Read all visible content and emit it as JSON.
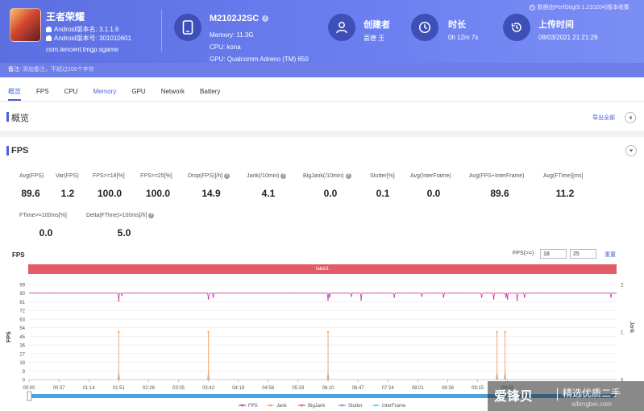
{
  "app": {
    "title": "王者荣耀",
    "version_line": "Android版本名: 3.1.1.6",
    "code_line": "Android版本号: 301010601",
    "package": "com.tencent.tmgp.sgame"
  },
  "device": {
    "name": "M2102J2SC",
    "memory": "Memory: 11.3G",
    "cpu": "CPU: kona",
    "gpu": "GPU: Qualcomm Adreno (TM) 650"
  },
  "creator": {
    "label": "创建者",
    "value": "喜德 王"
  },
  "duration": {
    "label": "时长",
    "value": "0h 12m 7s"
  },
  "upload": {
    "label": "上传时间",
    "value": "08/03/2021 21:21:29"
  },
  "source_note": "数据由PerfDog(5.1.210204)版本收集",
  "remark": {
    "label": "备注:",
    "placeholder": "添加备注，不超过200个字符"
  },
  "tabs": [
    "概览",
    "FPS",
    "CPU",
    "Memory",
    "GPU",
    "Network",
    "Battery"
  ],
  "active_tab": "概览",
  "overview": {
    "title": "概览",
    "export": "导出全部"
  },
  "fps_section": {
    "title": "FPS"
  },
  "metrics": [
    {
      "label": "Avg(FPS)",
      "value": "89.6",
      "help": false
    },
    {
      "label": "Var(FPS)",
      "value": "1.2",
      "help": false
    },
    {
      "label": "FPS>=18[%]",
      "value": "100.0",
      "help": false
    },
    {
      "label": "FPS>=25[%]",
      "value": "100.0",
      "help": false
    },
    {
      "label": "Drop(FPS)[/h]",
      "value": "14.9",
      "help": true
    },
    {
      "label": "Jank(/10min)",
      "value": "4.1",
      "help": true
    },
    {
      "label": "BigJank(/10min)",
      "value": "0.0",
      "help": true
    },
    {
      "label": "Stutter[%]",
      "value": "0.1",
      "help": false
    },
    {
      "label": "Avg(InterFrame)",
      "value": "0.0",
      "help": false
    },
    {
      "label": "Avg(FPS+InterFrame)",
      "value": "89.6",
      "help": false
    },
    {
      "label": "Avg(FTime)[ms]",
      "value": "11.2",
      "help": false
    },
    {
      "label": "FTime>=100ms[%]",
      "value": "0.0",
      "help": false
    },
    {
      "label": "Delta(FTime)>100ms[/h]",
      "value": "5.0",
      "help": true
    }
  ],
  "chart_controls": {
    "title": "FPS",
    "threshold_label": "FPS(>=)",
    "threshold_1": "18",
    "threshold_2": "25",
    "reset": "重置",
    "band_label": "label1"
  },
  "chart_data": {
    "type": "line",
    "ylabel": "FPS",
    "y2label": "Jank",
    "ylim": [
      0,
      99
    ],
    "y_ticks": [
      0,
      9,
      18,
      27,
      36,
      45,
      54,
      63,
      72,
      81,
      90,
      99
    ],
    "y2lim": [
      0,
      2
    ],
    "y2_ticks": [
      0,
      1,
      2
    ],
    "x_ticks": [
      "00:00",
      "00:37",
      "01:14",
      "01:51",
      "02:28",
      "03:05",
      "03:42",
      "04:19",
      "04:56",
      "05:33",
      "06:10",
      "06:47",
      "07:24",
      "08:01",
      "08:38",
      "09:15",
      "09:52"
    ],
    "duration_seconds": 727,
    "fps_baseline": 90,
    "fps_dips": [
      {
        "t": 111,
        "value": 82
      },
      {
        "t": 115,
        "value": 88
      },
      {
        "t": 222,
        "value": 84
      },
      {
        "t": 228,
        "value": 86
      },
      {
        "t": 370,
        "value": 83
      },
      {
        "t": 372,
        "value": 86
      },
      {
        "t": 399,
        "value": 87
      },
      {
        "t": 411,
        "value": 83
      },
      {
        "t": 452,
        "value": 86
      },
      {
        "t": 486,
        "value": 87
      },
      {
        "t": 513,
        "value": 86
      },
      {
        "t": 560,
        "value": 86
      },
      {
        "t": 575,
        "value": 84
      },
      {
        "t": 590,
        "value": 86
      },
      {
        "t": 592,
        "value": 84
      },
      {
        "t": 604,
        "value": 83
      },
      {
        "t": 613,
        "value": 86
      },
      {
        "t": 720,
        "value": 86
      }
    ],
    "jank_events": [
      111,
      222,
      370,
      579,
      589
    ],
    "stutter_events": [
      111,
      222,
      370,
      579,
      589
    ],
    "stutter_value": 11,
    "series": [
      {
        "name": "FPS",
        "color": "#c23ea4"
      },
      {
        "name": "Jank",
        "color": "#f4a56b"
      },
      {
        "name": "BigJank",
        "color": "#e8545a"
      },
      {
        "name": "Stutter",
        "color": "#7f97b6"
      },
      {
        "name": "InterFrame",
        "color": "#5fd0c9"
      }
    ]
  },
  "watermark": {
    "brand": "爱锋贝",
    "slogan": "精选优质二手",
    "url": "aifengbei.com"
  }
}
